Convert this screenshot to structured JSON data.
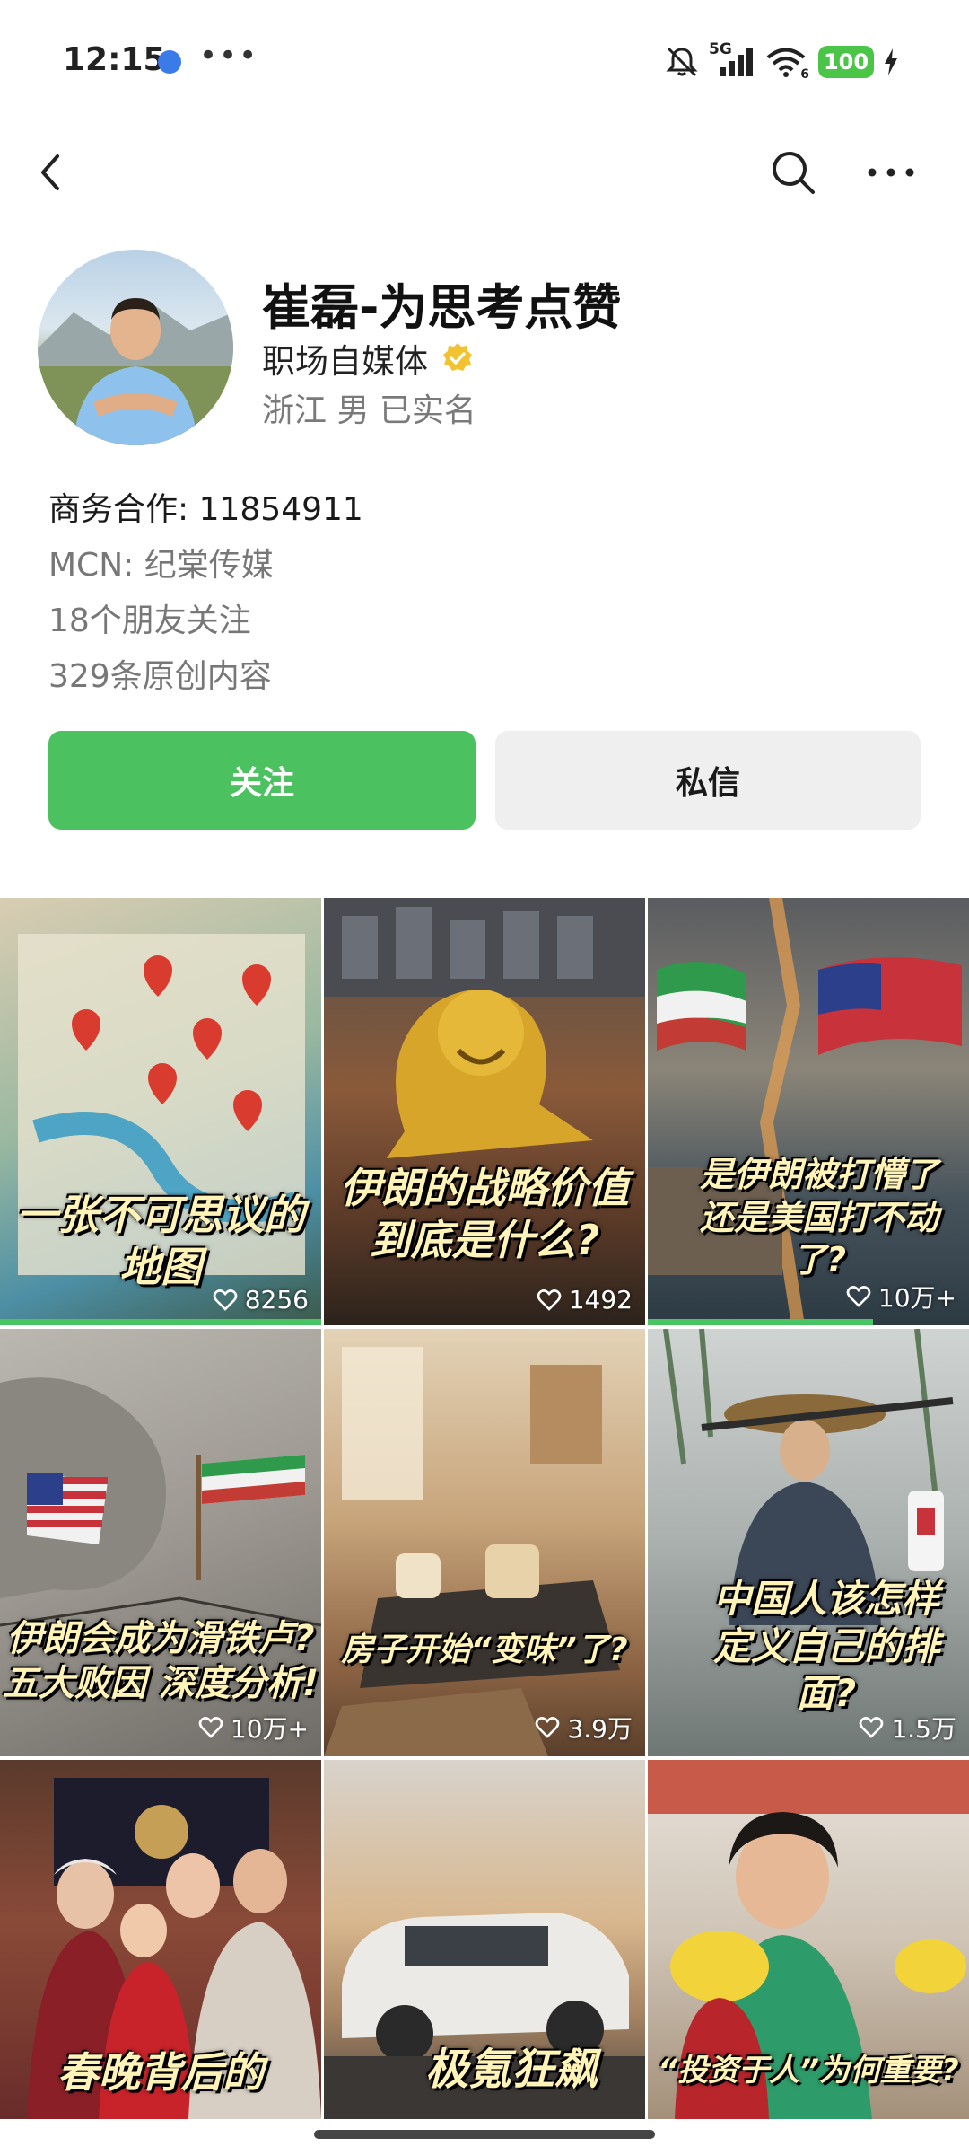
{
  "status_bar": {
    "time": "12:15",
    "more": "•••",
    "network": "5G",
    "wifi_sub": "6",
    "battery": "100",
    "icons": [
      "app-badge-icon",
      "mute-icon",
      "signal-icon",
      "wifi-icon",
      "battery-icon",
      "charging-icon"
    ]
  },
  "nav": {
    "icons": [
      "back-icon",
      "search-icon",
      "more-icon"
    ]
  },
  "profile": {
    "name": "崔磊-为思考点赞",
    "category": "职场自媒体",
    "meta": "浙江  男  已实名",
    "verified_color": "#f2c230",
    "business": "商务合作: 11854911",
    "mcn": "MCN: 纪棠传媒",
    "friends": "18个朋友关注",
    "original": "329条原创内容"
  },
  "actions": {
    "follow": "关注",
    "message": "私信",
    "follow_color": "#4cc15f"
  },
  "videos": [
    {
      "caption": "一张不可思议的\n地图",
      "likes": "8256",
      "progress": 1.0
    },
    {
      "caption": "伊朗的战略价值\n到底是什么?",
      "likes": "1492",
      "progress": 0
    },
    {
      "caption": "是伊朗被打懵了\n还是美国打不动了?",
      "likes": "10万+",
      "progress": 0.7
    },
    {
      "caption": "伊朗会成为滑铁卢?\n五大败因 深度分析!",
      "likes": "10万+",
      "progress": 0
    },
    {
      "caption": "房子开始“变味”了?",
      "likes": "3.9万",
      "progress": 0
    },
    {
      "caption": "中国人该怎样\n定义自己的排面?",
      "likes": "1.5万",
      "progress": 0
    },
    {
      "caption": "春晚背后的",
      "likes": "",
      "progress": 0
    },
    {
      "caption": "极氪狂飙",
      "likes": "",
      "progress": 0
    },
    {
      "caption": "“投资于人”为何重要?",
      "likes": "",
      "progress": 0
    }
  ]
}
